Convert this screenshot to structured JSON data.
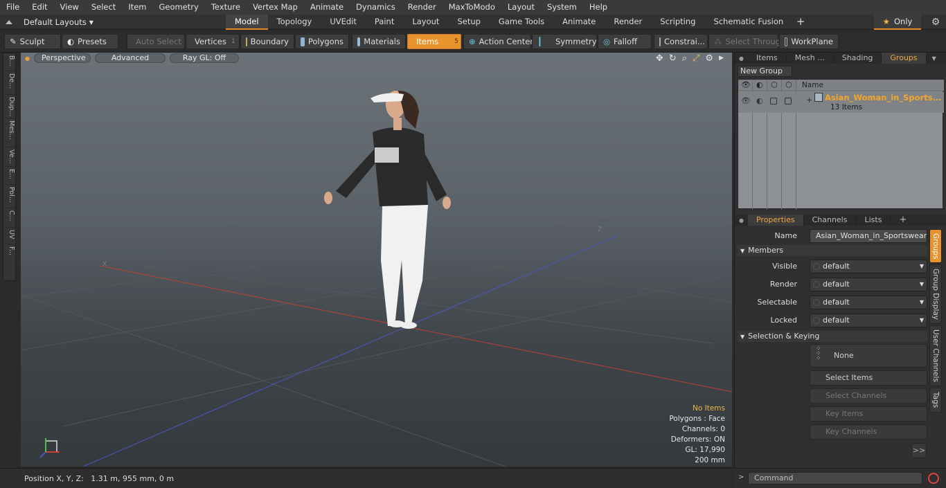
{
  "menu": [
    "File",
    "Edit",
    "View",
    "Select",
    "Item",
    "Geometry",
    "Texture",
    "Vertex Map",
    "Animate",
    "Dynamics",
    "Render",
    "MaxToModo",
    "Layout",
    "System",
    "Help"
  ],
  "layouts": {
    "label": "Default Layouts"
  },
  "tabs": [
    {
      "label": "Model",
      "active": true
    },
    {
      "label": "Topology"
    },
    {
      "label": "UVEdit"
    },
    {
      "label": "Paint"
    },
    {
      "label": "Layout"
    },
    {
      "label": "Setup"
    },
    {
      "label": "Game Tools"
    },
    {
      "label": "Animate"
    },
    {
      "label": "Render"
    },
    {
      "label": "Scripting"
    },
    {
      "label": "Schematic Fusion"
    }
  ],
  "tabs_plus": "+",
  "only_label": "Only",
  "toolbar": {
    "sculpt": "Sculpt",
    "presets": "Presets",
    "auto_select": "Auto Select",
    "vertices": "Vertices",
    "vertices_count": "1",
    "boundary": "Boundary",
    "polygons": "Polygons",
    "materials": "Materials",
    "items": "Items",
    "items_count": "5",
    "action_center": "Action Center",
    "symmetry": "Symmetry",
    "falloff": "Falloff",
    "constraints": "Constrai...",
    "select_through": "Select Through",
    "workplane": "WorkPlane"
  },
  "left_tabs": [
    "B...",
    "De...",
    "Dup...",
    "Mes...",
    "Ve...",
    "E...",
    "Pol...",
    "C...",
    "UV",
    "F..."
  ],
  "viewport": {
    "view_mode": "Perspective",
    "shading": "Advanced",
    "raygl": "Ray GL: Off",
    "axis_x": "X",
    "axis_z": "Z",
    "stats": {
      "items": "No Items",
      "polygons": "Polygons : Face",
      "channels": "Channels: 0",
      "deformers": "Deformers: ON",
      "gl": "GL: 17,990",
      "scale": "200 mm"
    }
  },
  "status": {
    "position": "Position X, Y, Z:   1.31 m, 955 mm, 0 m"
  },
  "groups_panel": {
    "tabs": [
      "Items",
      "Mesh ...",
      "Shading",
      "Groups"
    ],
    "active_tab": "Groups",
    "new_group": "New Group",
    "col_name": "Name",
    "group_name": "Asian_Woman_in_Sports...",
    "group_count": "13 Items"
  },
  "properties_panel": {
    "tabs": [
      "Properties",
      "Channels",
      "Lists"
    ],
    "plus": "+",
    "name_label": "Name",
    "name_value": "Asian_Woman_in_Sportswear_T...",
    "members_section": "Members",
    "visible_label": "Visible",
    "visible_value": "default",
    "render_label": "Render",
    "render_value": "default",
    "selectable_label": "Selectable",
    "selectable_value": "default",
    "locked_label": "Locked",
    "locked_value": "default",
    "keying_section": "Selection & Keying",
    "none_btn": "None",
    "select_items": "Select Items",
    "select_channels": "Select Channels",
    "key_items": "Key Items",
    "key_channels": "Key Channels",
    "more": ">>"
  },
  "side_tabs": [
    "Groups",
    "Group Display",
    "User Channels",
    "Tags"
  ],
  "command": {
    "placeholder": "Command"
  },
  "colors": {
    "accent": "#e8932e",
    "group_title": "#f5a627",
    "stat_highlight": "#f0b74a"
  }
}
